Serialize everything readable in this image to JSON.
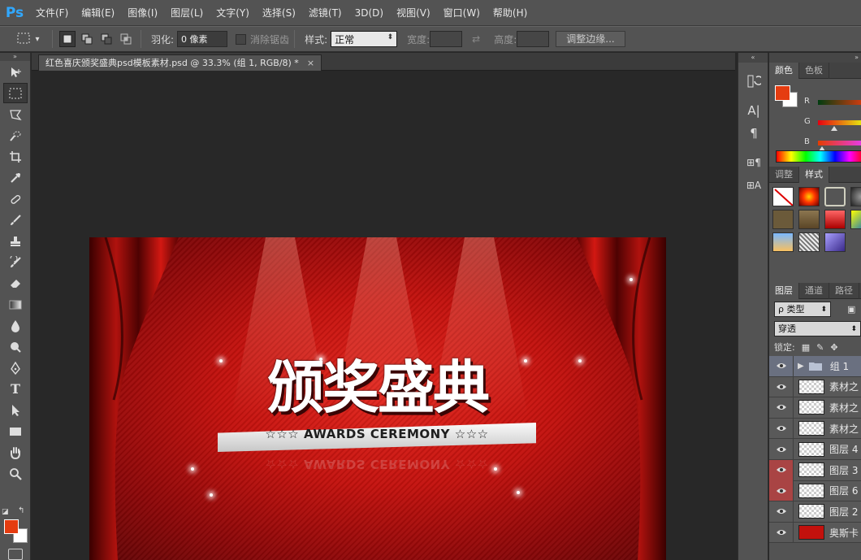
{
  "app": {
    "logo": "Ps"
  },
  "menu": [
    "文件(F)",
    "编辑(E)",
    "图像(I)",
    "图层(L)",
    "文字(Y)",
    "选择(S)",
    "滤镜(T)",
    "3D(D)",
    "视图(V)",
    "窗口(W)",
    "帮助(H)"
  ],
  "options": {
    "feather_label": "羽化:",
    "feather_value": "0 像素",
    "antialias_label": "消除锯齿",
    "style_label": "样式:",
    "style_value": "正常",
    "width_label": "宽度:",
    "height_label": "高度:",
    "refine_button": "调整边缘..."
  },
  "document": {
    "tab_title": "红色喜庆颁奖盛典psd模板素材.psd @ 33.3% (组 1, RGB/8) *",
    "close_glyph": "×"
  },
  "canvas_art": {
    "title": "颁奖盛典",
    "subtitle": "☆☆☆ AWARDS CEREMONY ☆☆☆",
    "background_color": "#c3110d"
  },
  "colors": {
    "foreground": "#e53c10",
    "background": "#ffffff"
  },
  "color_panel": {
    "tabs": [
      "颜色",
      "色板"
    ],
    "active_tab": 0,
    "channels": [
      {
        "label": "R",
        "gradient": "linear-gradient(90deg,#003c10,#e53c10)"
      },
      {
        "label": "G",
        "gradient": "linear-gradient(90deg,#e50010,#e5ff10)"
      },
      {
        "label": "B",
        "gradient": "linear-gradient(90deg,#e53c00,#e53cff)"
      }
    ]
  },
  "styles_panel": {
    "tabs": [
      "调整",
      "样式"
    ],
    "active_tab": 1
  },
  "layers_panel": {
    "tabs": [
      "图层",
      "通道",
      "路径"
    ],
    "active_tab": 0,
    "filter_label": "ρ 类型",
    "blend_mode": "穿透",
    "lock_label": "锁定:",
    "layers": [
      {
        "name": "组 1",
        "type": "group",
        "selected": true,
        "eye_highlight": false
      },
      {
        "name": "素材之",
        "type": "layer",
        "selected": false,
        "eye_highlight": false
      },
      {
        "name": "素材之",
        "type": "layer",
        "selected": false,
        "eye_highlight": false
      },
      {
        "name": "素材之",
        "type": "layer",
        "selected": false,
        "eye_highlight": false
      },
      {
        "name": "图层 4",
        "type": "layer",
        "selected": false,
        "eye_highlight": false
      },
      {
        "name": "图层 3",
        "type": "layer",
        "selected": false,
        "eye_highlight": true
      },
      {
        "name": "图层 6",
        "type": "layer",
        "selected": false,
        "eye_highlight": true
      },
      {
        "name": "图层 2",
        "type": "layer",
        "selected": false,
        "eye_highlight": false
      },
      {
        "name": "奥斯卡",
        "type": "layer",
        "selected": false,
        "eye_highlight": false,
        "thumb_color": "#c3110d"
      }
    ]
  }
}
